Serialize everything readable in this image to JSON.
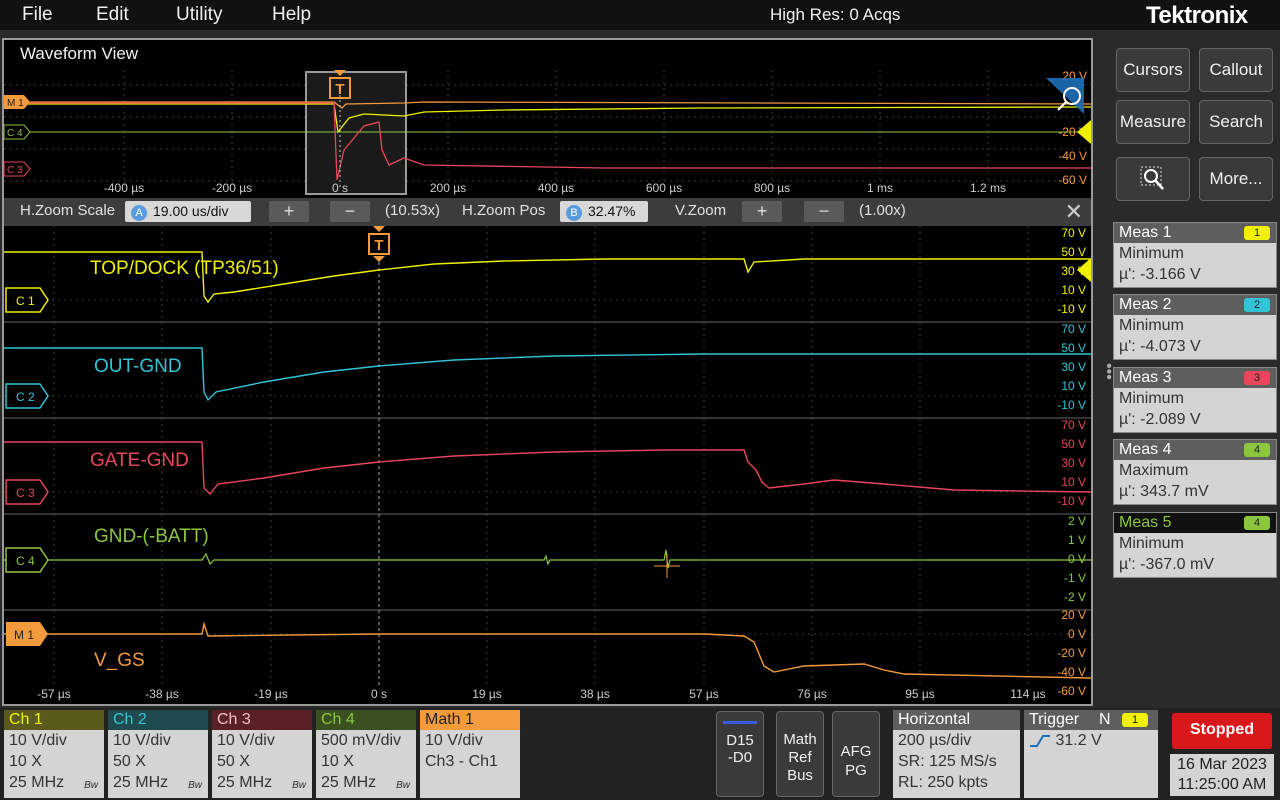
{
  "menu": {
    "file": "File",
    "edit": "Edit",
    "utility": "Utility",
    "help": "Help"
  },
  "acquisition_status": "High Res: 0 Acqs",
  "brand": "Tektronix",
  "waveform_view": {
    "title": "Waveform View",
    "overview": {
      "time_labels": [
        "-400 µs",
        "-200 µs",
        "0 s",
        "200 µs",
        "400 µs",
        "600 µs",
        "800 µs",
        "1 ms",
        "1.2 ms"
      ],
      "volt_labels": [
        "-20 V",
        "-40 V",
        "-60 V"
      ],
      "top_label": "20 V",
      "channel_tags": [
        "M 1",
        "C 4",
        "C 3"
      ]
    },
    "zoom_bar": {
      "h_zoom_scale_label": "H.Zoom Scale",
      "h_zoom_scale_badge": "A",
      "h_zoom_scale_value": "19.00 us/div",
      "h_zoom_factor": "(10.53x)",
      "h_zoom_pos_label": "H.Zoom Pos",
      "h_zoom_pos_badge": "B",
      "h_zoom_pos_value": "32.47%",
      "v_zoom_label": "V.Zoom",
      "v_zoom_factor": "(1.00x)",
      "plus": "+",
      "minus": "−",
      "close": "✕"
    },
    "trigger_marker": "T",
    "channels": [
      {
        "tag": "C 1",
        "name": "TOP/DOCK (TP36/51)",
        "color": "#f0f000",
        "scale": [
          "70 V",
          "50 V",
          "30 V",
          "10 V",
          "-10 V"
        ]
      },
      {
        "tag": "C 2",
        "name": "OUT-GND",
        "color": "#33c4d8",
        "scale": [
          "70 V",
          "50 V",
          "30 V",
          "10 V",
          "-10 V"
        ]
      },
      {
        "tag": "C 3",
        "name": "GATE-GND",
        "color": "#e8465a",
        "scale": [
          "70 V",
          "50 V",
          "30 V",
          "10 V",
          "-10 V"
        ]
      },
      {
        "tag": "C 4",
        "name": "GND-(-BATT)",
        "color": "#8cc63f",
        "scale": [
          "2 V",
          "1 V",
          "0 V",
          "-1 V",
          "-2 V"
        ]
      },
      {
        "tag": "M 1",
        "name": "V_GS",
        "color": "#f39a3c",
        "scale": [
          "20 V",
          "0 V",
          "-20 V",
          "-40 V",
          "-60 V"
        ]
      }
    ],
    "time_axis": [
      "-57 µs",
      "-38 µs",
      "-19 µs",
      "0 s",
      "19 µs",
      "38 µs",
      "57 µs",
      "76 µs",
      "95 µs",
      "114 µs"
    ]
  },
  "right_panel": {
    "buttons": {
      "cursors": "Cursors",
      "callout": "Callout",
      "measure": "Measure",
      "search": "Search",
      "more": "More..."
    },
    "measurements": [
      {
        "title": "Meas 1",
        "badge": "1",
        "badge_color": "#f0f000",
        "type": "Minimum",
        "value": "µ': -3.166 V"
      },
      {
        "title": "Meas 2",
        "badge": "2",
        "badge_color": "#33c4d8",
        "type": "Minimum",
        "value": "µ': -4.073 V"
      },
      {
        "title": "Meas 3",
        "badge": "3",
        "badge_color": "#e8465a",
        "type": "Minimum",
        "value": "µ': -2.089 V"
      },
      {
        "title": "Meas 4",
        "badge": "4",
        "badge_color": "#8cc63f",
        "type": "Maximum",
        "value": "µ': 343.7 mV"
      },
      {
        "title": "Meas 5",
        "badge": "4",
        "badge_color": "#8cc63f",
        "type": "Minimum",
        "value": "µ': -367.0 mV"
      }
    ]
  },
  "bottom_bar": {
    "channels": [
      {
        "title": "Ch 1",
        "color": "#f0f000",
        "vdiv": "10 V/div",
        "probe": "10 X",
        "bw": "25 MHz",
        "bw_tag": "Bw"
      },
      {
        "title": "Ch 2",
        "color": "#33c4d8",
        "vdiv": "10 V/div",
        "probe": "50 X",
        "bw": "25 MHz",
        "bw_tag": "Bw"
      },
      {
        "title": "Ch 3",
        "color": "#e8465a",
        "vdiv": "10 V/div",
        "probe": "50 X",
        "bw": "25 MHz",
        "bw_tag": "Bw"
      },
      {
        "title": "Ch 4",
        "color": "#8cc63f",
        "vdiv": "500 mV/div",
        "probe": "10 X",
        "bw": "25 MHz",
        "bw_tag": "Bw"
      }
    ],
    "math": {
      "title": "Math 1",
      "vdiv": "10 V/div",
      "expr": "Ch3 - Ch1"
    },
    "digital_button": {
      "line1": "D15",
      "line2": "-D0"
    },
    "math_ref_bus_button": {
      "line1": "Math",
      "line2": "Ref",
      "line3": "Bus"
    },
    "afg_button": {
      "line1": "AFG",
      "line2": "PG"
    },
    "horizontal": {
      "title": "Horizontal",
      "scale": "200 µs/div",
      "sample_rate": "SR: 125 MS/s",
      "record_length": "RL: 250 kpts"
    },
    "trigger": {
      "title": "Trigger",
      "mode": "N",
      "source_badge": "1",
      "level": "31.2 V"
    },
    "run_state": "Stopped",
    "date": "16 Mar 2023",
    "time": "11:25:00 AM"
  }
}
